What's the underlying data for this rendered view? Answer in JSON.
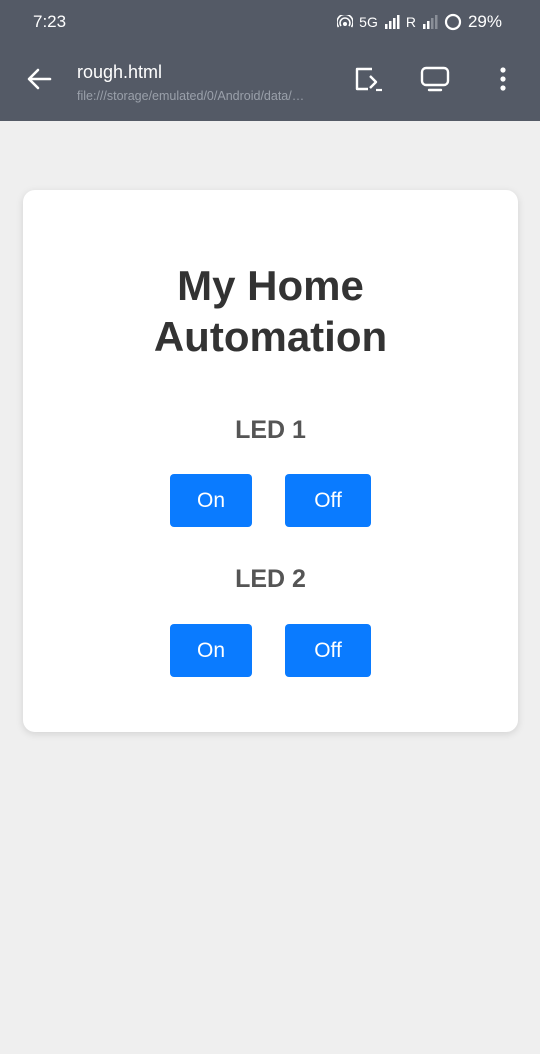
{
  "status_bar": {
    "time": "7:23",
    "network": "5G",
    "roaming": "R",
    "battery": "29%"
  },
  "app_bar": {
    "title": "rough.html",
    "url": "file:///storage/emulated/0/Android/data/…",
    "icons": [
      "back-arrow-icon",
      "share-icon",
      "cast-screen-icon",
      "more-vert-icon"
    ]
  },
  "card": {
    "heading_line1": "My Home",
    "heading_line2": "Automation",
    "leds": [
      {
        "label": "LED 1",
        "on_label": "On",
        "off_label": "Off"
      },
      {
        "label": "LED 2",
        "on_label": "On",
        "off_label": "Off"
      }
    ]
  },
  "colors": {
    "toolbar": "#545a66",
    "button": "#0a7bff",
    "background": "#efefef",
    "card": "#ffffff"
  }
}
